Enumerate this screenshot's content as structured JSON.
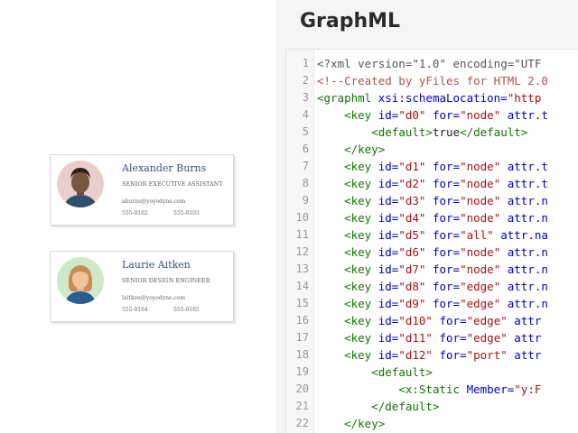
{
  "cards": [
    {
      "name": "Alexander Burns",
      "role": "SENIOR EXECUTIVE ASSISTANT",
      "email": "aburns@yoyodyne.com",
      "phone": "555-0102",
      "fax": "555-0103"
    },
    {
      "name": "Laurie Aitken",
      "role": "SENIOR DESIGN ENGINEER",
      "email": "laitken@yoyodyne.com",
      "phone": "555-0164",
      "fax": "555-0165"
    }
  ],
  "panel": {
    "title": "GraphML"
  },
  "code_lines": [
    {
      "num": "1",
      "indent": "",
      "segments": [
        {
          "t": "<?xml version=\"1.0\" encoding=\"UTF",
          "c": "meta"
        }
      ]
    },
    {
      "num": "2",
      "indent": "",
      "segments": [
        {
          "t": "<!--Created by yFiles for HTML 2.0",
          "c": "comment"
        }
      ]
    },
    {
      "num": "3",
      "indent": "",
      "segments": [
        {
          "t": "<graphml",
          "c": "tag"
        },
        {
          "t": " xsi:schemaLocation=",
          "c": "attr"
        },
        {
          "t": "\"http",
          "c": "str"
        }
      ]
    },
    {
      "num": "4",
      "indent": "    ",
      "segments": [
        {
          "t": "<key",
          "c": "tag"
        },
        {
          "t": " id=",
          "c": "attr"
        },
        {
          "t": "\"d0\"",
          "c": "str"
        },
        {
          "t": " for=",
          "c": "attr"
        },
        {
          "t": "\"node\"",
          "c": "str"
        },
        {
          "t": " attr.t",
          "c": "attr"
        }
      ]
    },
    {
      "num": "5",
      "indent": "        ",
      "segments": [
        {
          "t": "<default>",
          "c": "tag"
        },
        {
          "t": "true",
          "c": "text"
        },
        {
          "t": "</default>",
          "c": "tag"
        }
      ]
    },
    {
      "num": "6",
      "indent": "    ",
      "segments": [
        {
          "t": "</key>",
          "c": "tag"
        }
      ]
    },
    {
      "num": "7",
      "indent": "    ",
      "segments": [
        {
          "t": "<key",
          "c": "tag"
        },
        {
          "t": " id=",
          "c": "attr"
        },
        {
          "t": "\"d1\"",
          "c": "str"
        },
        {
          "t": " for=",
          "c": "attr"
        },
        {
          "t": "\"node\"",
          "c": "str"
        },
        {
          "t": " attr.t",
          "c": "attr"
        }
      ]
    },
    {
      "num": "8",
      "indent": "    ",
      "segments": [
        {
          "t": "<key",
          "c": "tag"
        },
        {
          "t": " id=",
          "c": "attr"
        },
        {
          "t": "\"d2\"",
          "c": "str"
        },
        {
          "t": " for=",
          "c": "attr"
        },
        {
          "t": "\"node\"",
          "c": "str"
        },
        {
          "t": " attr.t",
          "c": "attr"
        }
      ]
    },
    {
      "num": "9",
      "indent": "    ",
      "segments": [
        {
          "t": "<key",
          "c": "tag"
        },
        {
          "t": " id=",
          "c": "attr"
        },
        {
          "t": "\"d3\"",
          "c": "str"
        },
        {
          "t": " for=",
          "c": "attr"
        },
        {
          "t": "\"node\"",
          "c": "str"
        },
        {
          "t": " attr.n",
          "c": "attr"
        }
      ]
    },
    {
      "num": "10",
      "indent": "    ",
      "segments": [
        {
          "t": "<key",
          "c": "tag"
        },
        {
          "t": " id=",
          "c": "attr"
        },
        {
          "t": "\"d4\"",
          "c": "str"
        },
        {
          "t": " for=",
          "c": "attr"
        },
        {
          "t": "\"node\"",
          "c": "str"
        },
        {
          "t": " attr.n",
          "c": "attr"
        }
      ]
    },
    {
      "num": "11",
      "indent": "    ",
      "segments": [
        {
          "t": "<key",
          "c": "tag"
        },
        {
          "t": " id=",
          "c": "attr"
        },
        {
          "t": "\"d5\"",
          "c": "str"
        },
        {
          "t": " for=",
          "c": "attr"
        },
        {
          "t": "\"all\"",
          "c": "str"
        },
        {
          "t": " attr.na",
          "c": "attr"
        }
      ]
    },
    {
      "num": "12",
      "indent": "    ",
      "segments": [
        {
          "t": "<key",
          "c": "tag"
        },
        {
          "t": " id=",
          "c": "attr"
        },
        {
          "t": "\"d6\"",
          "c": "str"
        },
        {
          "t": " for=",
          "c": "attr"
        },
        {
          "t": "\"node\"",
          "c": "str"
        },
        {
          "t": " attr.n",
          "c": "attr"
        }
      ]
    },
    {
      "num": "13",
      "indent": "    ",
      "segments": [
        {
          "t": "<key",
          "c": "tag"
        },
        {
          "t": " id=",
          "c": "attr"
        },
        {
          "t": "\"d7\"",
          "c": "str"
        },
        {
          "t": " for=",
          "c": "attr"
        },
        {
          "t": "\"node\"",
          "c": "str"
        },
        {
          "t": " attr.n",
          "c": "attr"
        }
      ]
    },
    {
      "num": "14",
      "indent": "    ",
      "segments": [
        {
          "t": "<key",
          "c": "tag"
        },
        {
          "t": " id=",
          "c": "attr"
        },
        {
          "t": "\"d8\"",
          "c": "str"
        },
        {
          "t": " for=",
          "c": "attr"
        },
        {
          "t": "\"edge\"",
          "c": "str"
        },
        {
          "t": " attr.n",
          "c": "attr"
        }
      ]
    },
    {
      "num": "15",
      "indent": "    ",
      "segments": [
        {
          "t": "<key",
          "c": "tag"
        },
        {
          "t": " id=",
          "c": "attr"
        },
        {
          "t": "\"d9\"",
          "c": "str"
        },
        {
          "t": " for=",
          "c": "attr"
        },
        {
          "t": "\"edge\"",
          "c": "str"
        },
        {
          "t": " attr.n",
          "c": "attr"
        }
      ]
    },
    {
      "num": "16",
      "indent": "    ",
      "segments": [
        {
          "t": "<key",
          "c": "tag"
        },
        {
          "t": " id=",
          "c": "attr"
        },
        {
          "t": "\"d10\"",
          "c": "str"
        },
        {
          "t": " for=",
          "c": "attr"
        },
        {
          "t": "\"edge\"",
          "c": "str"
        },
        {
          "t": " attr",
          "c": "attr"
        }
      ]
    },
    {
      "num": "17",
      "indent": "    ",
      "segments": [
        {
          "t": "<key",
          "c": "tag"
        },
        {
          "t": " id=",
          "c": "attr"
        },
        {
          "t": "\"d11\"",
          "c": "str"
        },
        {
          "t": " for=",
          "c": "attr"
        },
        {
          "t": "\"edge\"",
          "c": "str"
        },
        {
          "t": " attr",
          "c": "attr"
        }
      ]
    },
    {
      "num": "18",
      "indent": "    ",
      "segments": [
        {
          "t": "<key",
          "c": "tag"
        },
        {
          "t": " id=",
          "c": "attr"
        },
        {
          "t": "\"d12\"",
          "c": "str"
        },
        {
          "t": " for=",
          "c": "attr"
        },
        {
          "t": "\"port\"",
          "c": "str"
        },
        {
          "t": " attr",
          "c": "attr"
        }
      ]
    },
    {
      "num": "19",
      "indent": "        ",
      "segments": [
        {
          "t": "<default>",
          "c": "tag"
        }
      ]
    },
    {
      "num": "20",
      "indent": "            ",
      "segments": [
        {
          "t": "<x:Static",
          "c": "tag"
        },
        {
          "t": " Member=",
          "c": "attr"
        },
        {
          "t": "\"y:F",
          "c": "str"
        }
      ]
    },
    {
      "num": "21",
      "indent": "        ",
      "segments": [
        {
          "t": "</default>",
          "c": "tag"
        }
      ]
    },
    {
      "num": "22",
      "indent": "    ",
      "segments": [
        {
          "t": "</key>",
          "c": "tag"
        }
      ]
    }
  ],
  "colors": {
    "tag": "#117700",
    "attr": "#0000cc",
    "string": "#aa1111",
    "comment": "#aa5555",
    "panel_bg": "#f5f5f5",
    "name_text": "#33527a"
  }
}
